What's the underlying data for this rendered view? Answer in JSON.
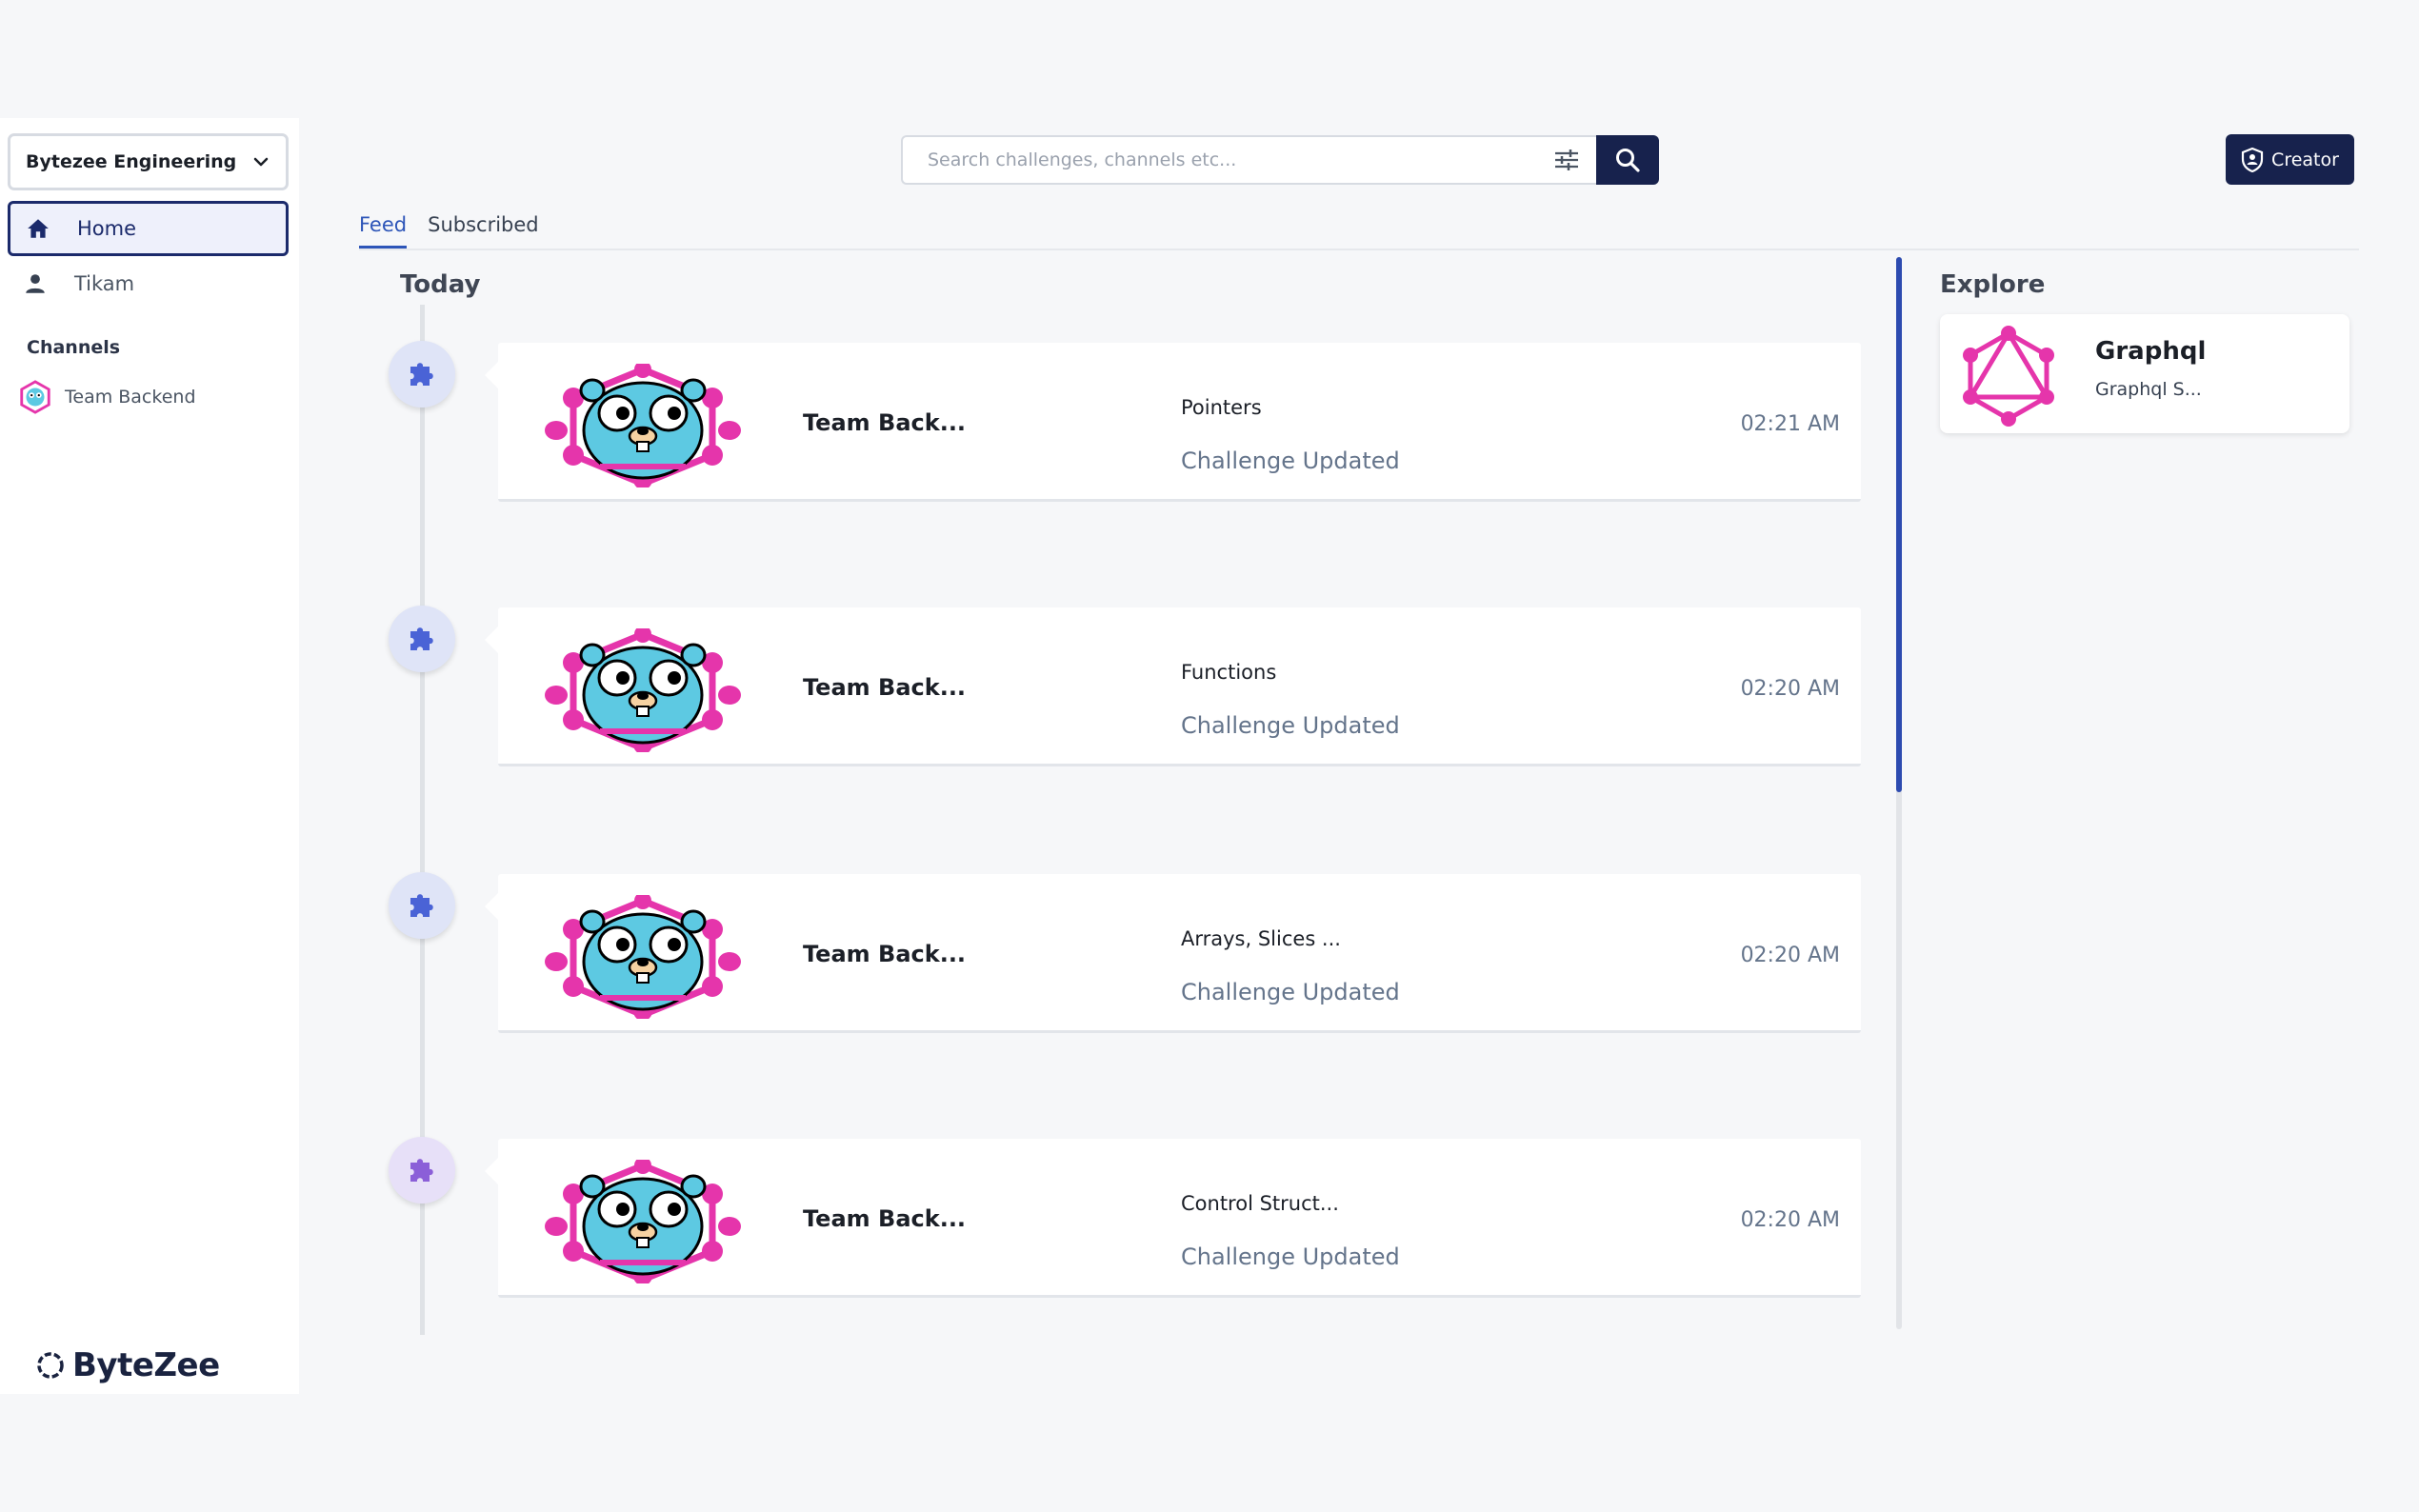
{
  "sidebar": {
    "org_name": "Bytezee Engineering",
    "nav": [
      {
        "label": "Home",
        "icon": "home-icon",
        "active": true
      },
      {
        "label": "Tikam",
        "icon": "person-icon",
        "active": false
      }
    ],
    "channels_heading": "Channels",
    "channels": [
      {
        "label": "Team Backend",
        "icon": "gopher-avatar"
      }
    ],
    "logo_text": "ByteZee"
  },
  "search": {
    "placeholder": "Search challenges, channels etc..."
  },
  "creator_label": "Creator",
  "tabs": [
    {
      "label": "Feed",
      "active": true
    },
    {
      "label": "Subscribed",
      "active": false
    }
  ],
  "feed": {
    "section_label": "Today",
    "items": [
      {
        "channel": "Team Back...",
        "challenge": "Pointers",
        "status": "Challenge Updated",
        "time": "02:21 AM"
      },
      {
        "channel": "Team Back...",
        "challenge": "Functions",
        "status": "Challenge Updated",
        "time": "02:20 AM"
      },
      {
        "channel": "Team Back...",
        "challenge": "Arrays, Slices ...",
        "status": "Challenge Updated",
        "time": "02:20 AM"
      },
      {
        "channel": "Team Back...",
        "challenge": "Control Struct...",
        "status": "Challenge Updated",
        "time": "02:20 AM"
      }
    ]
  },
  "explore": {
    "title": "Explore",
    "items": [
      {
        "name": "Graphql",
        "description": "Graphql S..."
      }
    ]
  },
  "colors": {
    "accent": "#17224d",
    "link": "#2d55b8",
    "graphql_pink": "#e535ab",
    "gopher_blue": "#5dc9e2"
  }
}
